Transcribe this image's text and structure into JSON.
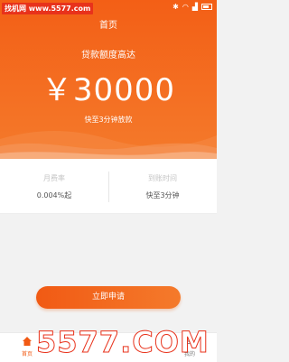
{
  "status_bar": {
    "watermark": "找机网 www.5577.com",
    "icons": [
      "bluetooth-icon",
      "wifi-icon",
      "signal-icon",
      "battery-icon"
    ]
  },
  "header": {
    "title": "首页"
  },
  "hero": {
    "subtitle": "贷款额度高达",
    "amount": "￥30000",
    "speed_note": "快至3分钟放款"
  },
  "info": [
    {
      "label": "月费率",
      "value": "0.004%起"
    },
    {
      "label": "到账时间",
      "value": "快至3分钟"
    }
  ],
  "apply_button": {
    "label": "立即申请"
  },
  "tabbar": {
    "tabs": [
      {
        "label": "首页",
        "icon": "home-icon",
        "active": true
      },
      {
        "label": "",
        "icon": "",
        "active": false
      },
      {
        "label": "",
        "icon": "",
        "active": false
      },
      {
        "label": "我的",
        "icon": "user-icon",
        "active": false
      }
    ]
  },
  "bottom_watermark": "5577.COM",
  "colors": {
    "accent": "#f15a14",
    "hero_light": "#f47a2b",
    "background": "#f2f2f2"
  }
}
